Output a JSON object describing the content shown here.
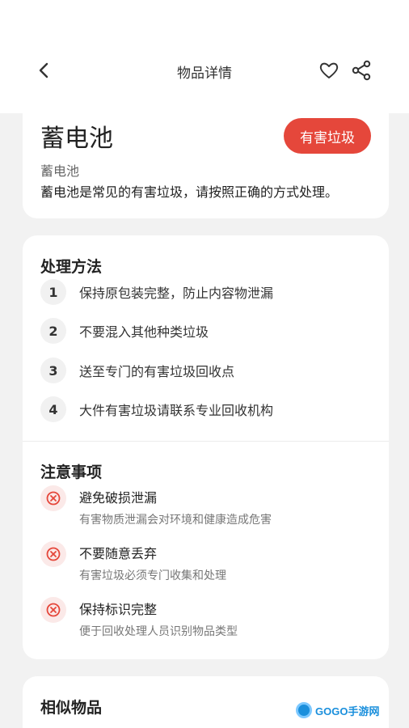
{
  "header": {
    "title": "物品详情"
  },
  "item": {
    "name": "蓄电池",
    "category_badge": "有害垃圾",
    "subtitle": "蓄电池",
    "description": "蓄电池是常见的有害垃圾，请按照正确的方式处理。"
  },
  "methods": {
    "title": "处理方法",
    "steps": [
      {
        "num": "1",
        "text": "保持原包装完整，防止内容物泄漏"
      },
      {
        "num": "2",
        "text": "不要混入其他种类垃圾"
      },
      {
        "num": "3",
        "text": "送至专门的有害垃圾回收点"
      },
      {
        "num": "4",
        "text": "大件有害垃圾请联系专业回收机构"
      }
    ]
  },
  "notes": {
    "title": "注意事项",
    "items": [
      {
        "title": "避免破损泄漏",
        "text": "有害物质泄漏会对环境和健康造成危害"
      },
      {
        "title": "不要随意丢弃",
        "text": "有害垃圾必须专门收集和处理"
      },
      {
        "title": "保持标识完整",
        "text": "便于回收处理人员识别物品类型"
      }
    ]
  },
  "similar": {
    "title": "相似物品"
  },
  "watermark": {
    "text": "GOGO手游网"
  },
  "colors": {
    "accent": "#e5473b",
    "note_icon_bg": "#fbe9e8"
  }
}
